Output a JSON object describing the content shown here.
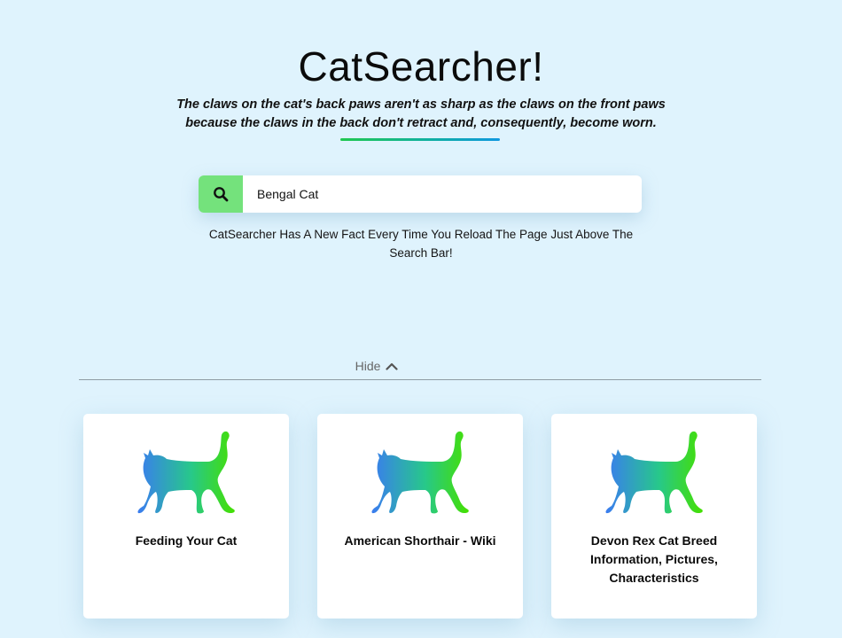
{
  "header": {
    "title": "CatSearcher!",
    "fact": "The claws on the cat's back paws aren't as sharp as the claws on the front paws because the claws in the back don't retract and, consequently, become worn."
  },
  "search": {
    "value": "Bengal Cat",
    "button_icon": "search-icon",
    "hint": "CatSearcher Has A New Fact Every Time You Reload The Page Just Above The Search Bar!"
  },
  "results_toggle": {
    "label": "Hide",
    "icon": "chevron-up-icon"
  },
  "results": [
    {
      "title": "Feeding Your Cat",
      "icon": "cat-icon"
    },
    {
      "title": "American Shorthair - Wiki",
      "icon": "cat-icon"
    },
    {
      "title": "Devon Rex Cat Breed Information, Pictures, Characteristics",
      "icon": "cat-icon"
    }
  ],
  "colors": {
    "background": "#dff3fd",
    "search_button": "#74e27c",
    "cat_gradient_start": "#3a7cf0",
    "cat_gradient_end": "#3fe000"
  }
}
